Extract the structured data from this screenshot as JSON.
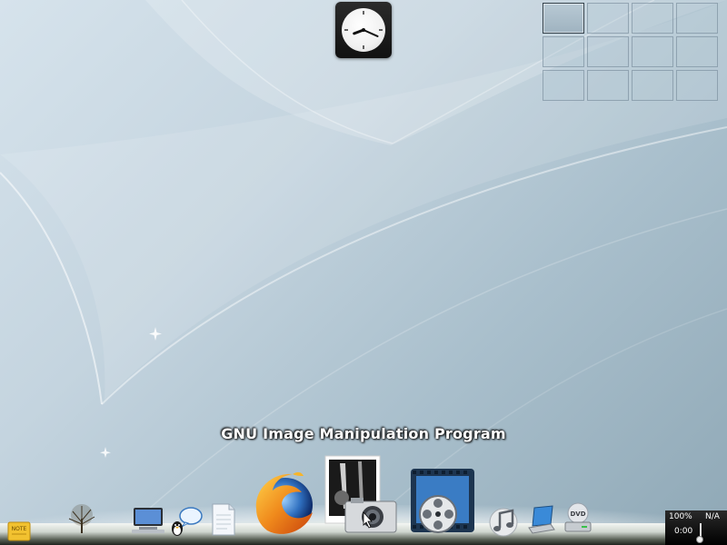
{
  "tooltip": {
    "text": "GNU Image Manipulation Program"
  },
  "clock": {
    "hour": 8,
    "minute": 19
  },
  "pager": {
    "columns": 4,
    "rows": 3,
    "active_workspace": 1
  },
  "dock": {
    "items": [
      {
        "name": "note-icon",
        "text": "NOTE"
      },
      {
        "name": "tree-wallpaper-icon"
      },
      {
        "name": "computer-icon"
      },
      {
        "name": "chat-messenger-icon"
      },
      {
        "name": "document-icon"
      },
      {
        "name": "firefox-icon"
      },
      {
        "name": "gimp-camera-icon"
      },
      {
        "name": "video-film-icon"
      },
      {
        "name": "music-notes-icon"
      },
      {
        "name": "laptop-icon"
      },
      {
        "name": "dvd-drive-icon",
        "text": "DVD"
      }
    ]
  },
  "tray": {
    "battery": "100%",
    "time": "0:00",
    "status": "N/A"
  },
  "colors": {
    "accent_blue": "#2f6fbf",
    "firefox_orange": "#f08a1c",
    "dock_dark": "#20241f"
  }
}
